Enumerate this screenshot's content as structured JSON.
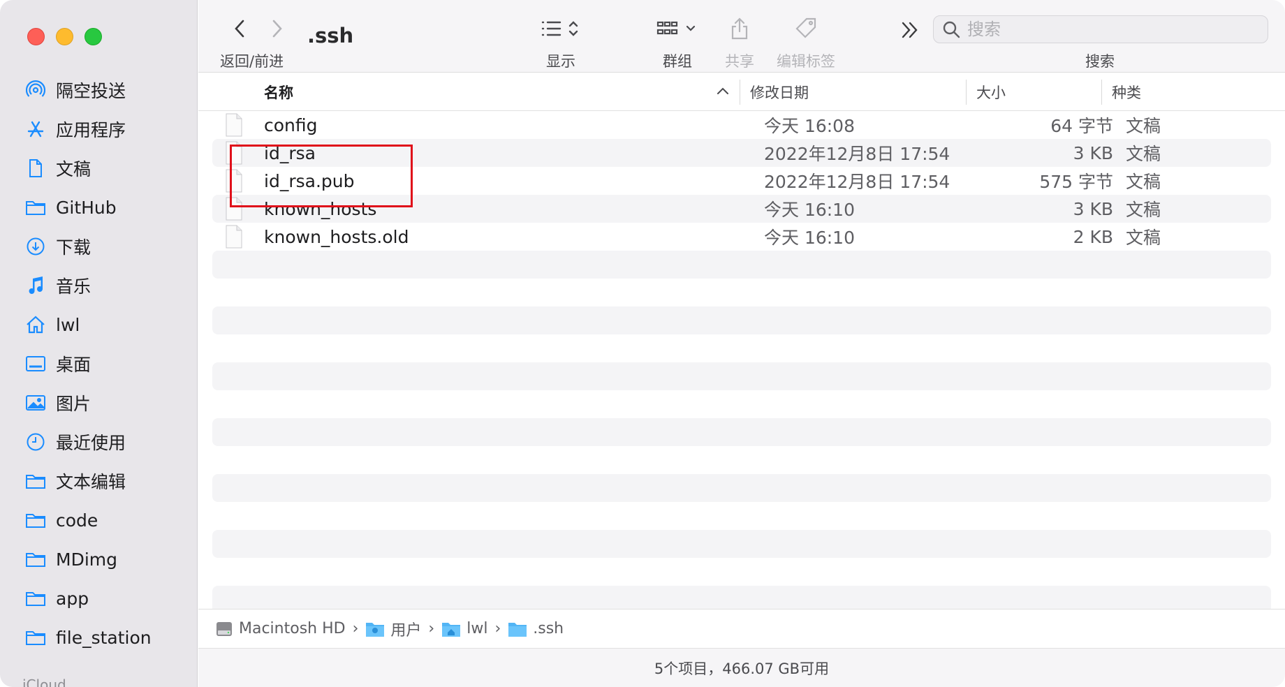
{
  "window": {
    "title": ".ssh"
  },
  "toolbar": {
    "nav_label": "返回/前进",
    "view_label": "显示",
    "group_label": "群组",
    "share_label": "共享",
    "tags_label": "编辑标签",
    "search_label": "搜索",
    "search_placeholder": "搜索"
  },
  "sidebar": {
    "items": [
      {
        "label": "隔空投送",
        "icon": "airdrop-icon"
      },
      {
        "label": "应用程序",
        "icon": "applications-icon"
      },
      {
        "label": "文稿",
        "icon": "document-icon"
      },
      {
        "label": "GitHub",
        "icon": "folder-icon"
      },
      {
        "label": "下载",
        "icon": "download-icon"
      },
      {
        "label": "音乐",
        "icon": "music-icon"
      },
      {
        "label": "lwl",
        "icon": "home-icon"
      },
      {
        "label": "桌面",
        "icon": "desktop-icon"
      },
      {
        "label": "图片",
        "icon": "photos-icon"
      },
      {
        "label": "最近使用",
        "icon": "clock-icon"
      },
      {
        "label": "文本编辑",
        "icon": "folder-icon"
      },
      {
        "label": "code",
        "icon": "folder-icon"
      },
      {
        "label": "MDimg",
        "icon": "folder-icon"
      },
      {
        "label": "app",
        "icon": "folder-icon"
      },
      {
        "label": "file_station",
        "icon": "folder-icon"
      }
    ],
    "section_label": "iCloud"
  },
  "columns": {
    "name": "名称",
    "date": "修改日期",
    "size": "大小",
    "kind": "种类"
  },
  "files": [
    {
      "name": "config",
      "date": "今天 16:08",
      "size": "64 字节",
      "kind": "文稿"
    },
    {
      "name": "id_rsa",
      "date": "2022年12月8日 17:54",
      "size": "3 KB",
      "kind": "文稿"
    },
    {
      "name": "id_rsa.pub",
      "date": "2022年12月8日 17:54",
      "size": "575 字节",
      "kind": "文稿"
    },
    {
      "name": "known_hosts",
      "date": "今天 16:10",
      "size": "3 KB",
      "kind": "文稿"
    },
    {
      "name": "known_hosts.old",
      "date": "今天 16:10",
      "size": "2 KB",
      "kind": "文稿"
    }
  ],
  "path": [
    {
      "label": "Macintosh HD",
      "icon": "hard-drive-icon"
    },
    {
      "label": "用户",
      "icon": "users-folder-icon"
    },
    {
      "label": "lwl",
      "icon": "home-folder-icon"
    },
    {
      "label": ".ssh",
      "icon": "folder-icon"
    }
  ],
  "status": {
    "text": "5个项目，466.07 GB可用"
  },
  "colors": {
    "accent": "#1a8cff",
    "highlight": "#e0101a",
    "sidebar_bg": "#e8e6ea"
  }
}
